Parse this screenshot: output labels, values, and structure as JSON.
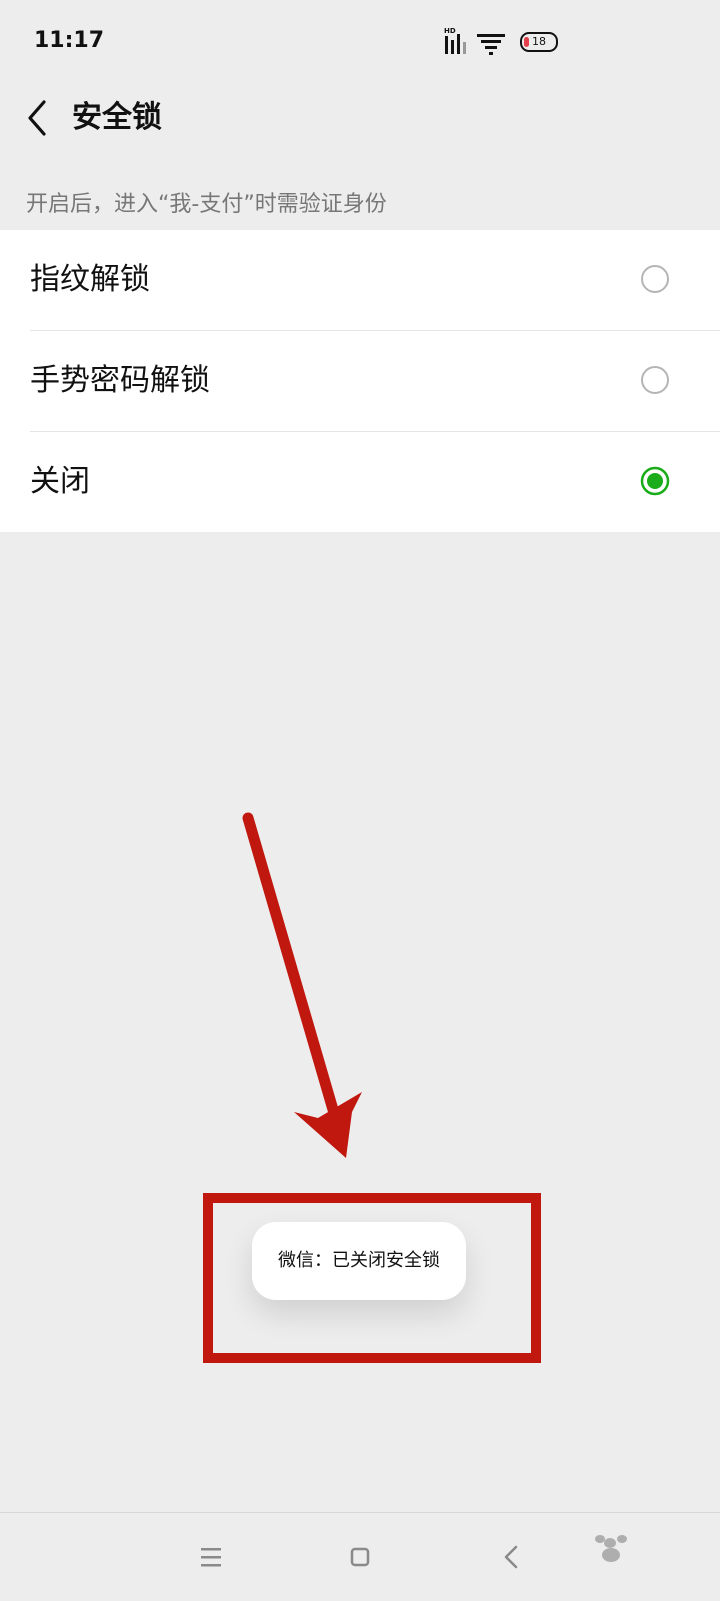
{
  "status_bar": {
    "time": "11:17",
    "battery_level": "18"
  },
  "header": {
    "title": "安全锁"
  },
  "description": "开启后，进入“我-支付”时需验证身份",
  "options": [
    {
      "label": "指纹解锁",
      "selected": false
    },
    {
      "label": "手势密码解锁",
      "selected": false
    },
    {
      "label": "关闭",
      "selected": true
    }
  ],
  "toast": {
    "text": "微信：已关闭安全锁"
  },
  "colors": {
    "accent_green": "#1aad19",
    "annotation_red": "#c0170f"
  },
  "icons": [
    "back-chevron-icon",
    "radio-icon",
    "menu-icon",
    "home-icon",
    "back-icon"
  ]
}
